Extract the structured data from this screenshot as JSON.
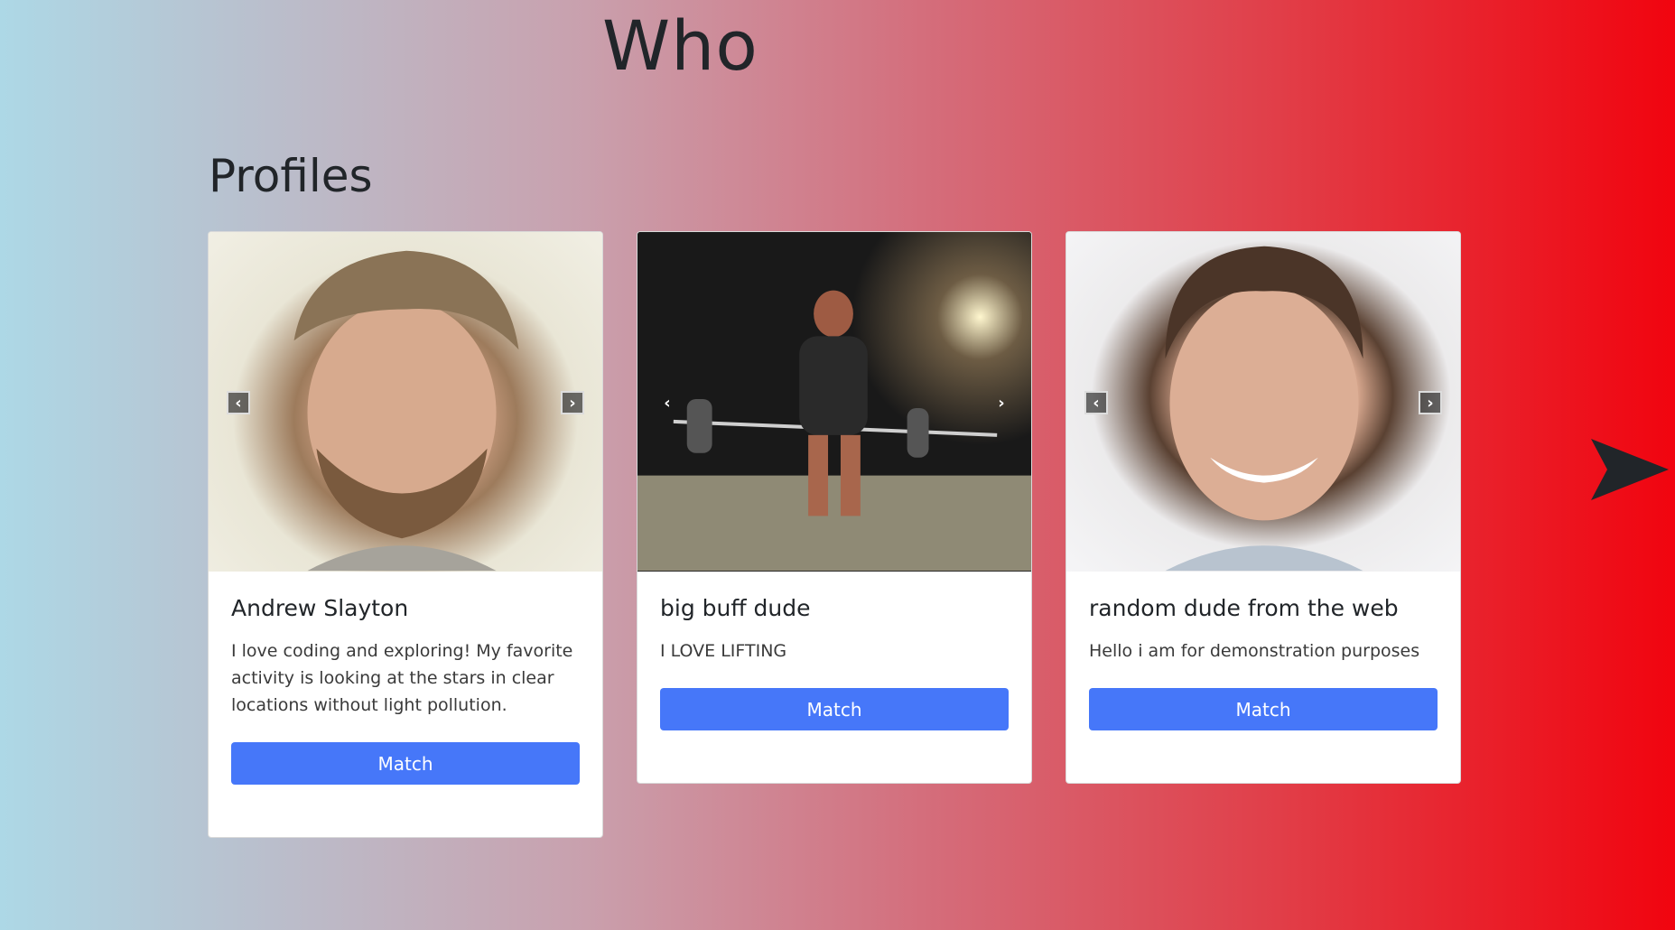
{
  "brand": "Who",
  "section_title": "Profiles",
  "profiles": [
    {
      "name": "Andrew Slayton",
      "bio": "I love coding and exploring! My favorite activity is looking at the stars in clear locations without light pollution.",
      "button": "Match"
    },
    {
      "name": "big buff dude",
      "bio": "I LOVE LIFTING",
      "button": "Match"
    },
    {
      "name": "random dude from the web",
      "bio": "Hello i am for demonstration purposes",
      "button": "Match"
    }
  ],
  "carousel": {
    "prev_symbol": "‹",
    "next_symbol": "›"
  },
  "colors": {
    "accent": "#4677f9",
    "gradient_start": "#add8e6",
    "gradient_end": "#f1040f"
  },
  "icons": {
    "next_profiles": "arrow-right-icon",
    "carousel_prev": "chevron-left-icon",
    "carousel_next": "chevron-right-icon"
  }
}
